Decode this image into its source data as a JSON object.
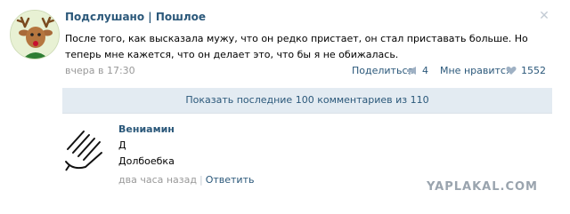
{
  "post": {
    "author": "Подслушано | Пошлое",
    "text": "После того, как высказала мужу, что он редко пристает, он стал приставать больше. Но теперь мне кажется, что он делает это, что бы я не обижалась.",
    "date": "вчера в 17:30",
    "share_label": "Поделиться",
    "share_count": "4",
    "like_label": "Мне нравится",
    "like_count": "1552",
    "close_icon": "close-icon"
  },
  "comments": {
    "show_more_label": "Показать последние 100 комментариев из 110",
    "items": [
      {
        "author": "Вениамин",
        "line1": "Д",
        "line2": "Долбоебка",
        "time": "два часа назад",
        "reply_label": "Ответить"
      }
    ]
  },
  "watermark": "YAPLAKAL.COM",
  "colors": {
    "link": "#2b587a",
    "meta": "#999999",
    "show_more_bg": "#e3ebf2"
  }
}
